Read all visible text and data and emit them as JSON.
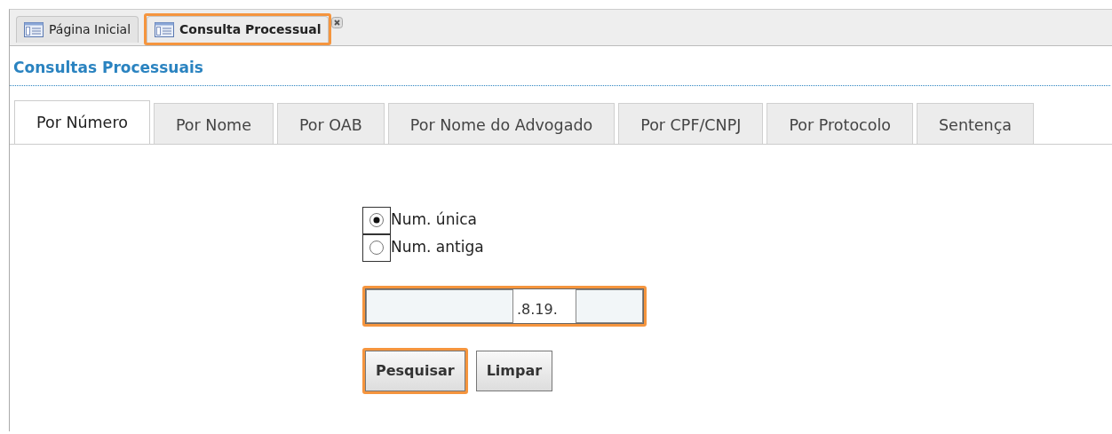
{
  "top_tabs": [
    {
      "label": "Página Inicial",
      "selected": false,
      "highlighted": false,
      "closable": false
    },
    {
      "label": "Consulta Processual",
      "selected": true,
      "highlighted": true,
      "closable": true
    }
  ],
  "page_title": "Consultas Processuais",
  "search_tabs": [
    {
      "label": "Por Número",
      "selected": true
    },
    {
      "label": "Por Nome",
      "selected": false
    },
    {
      "label": "Por OAB",
      "selected": false
    },
    {
      "label": "Por Nome do Advogado",
      "selected": false
    },
    {
      "label": "Por CPF/CNPJ",
      "selected": false
    },
    {
      "label": "Por Protocolo",
      "selected": false
    },
    {
      "label": "Sentença",
      "selected": false
    }
  ],
  "number_type": [
    {
      "label": "Num. única",
      "selected": true
    },
    {
      "label": "Num. antiga",
      "selected": false
    }
  ],
  "number_field": {
    "separator": ".8.19.",
    "highlighted": true
  },
  "buttons": [
    {
      "label": "Pesquisar",
      "highlighted": true
    },
    {
      "label": "Limpar",
      "highlighted": false
    }
  ]
}
